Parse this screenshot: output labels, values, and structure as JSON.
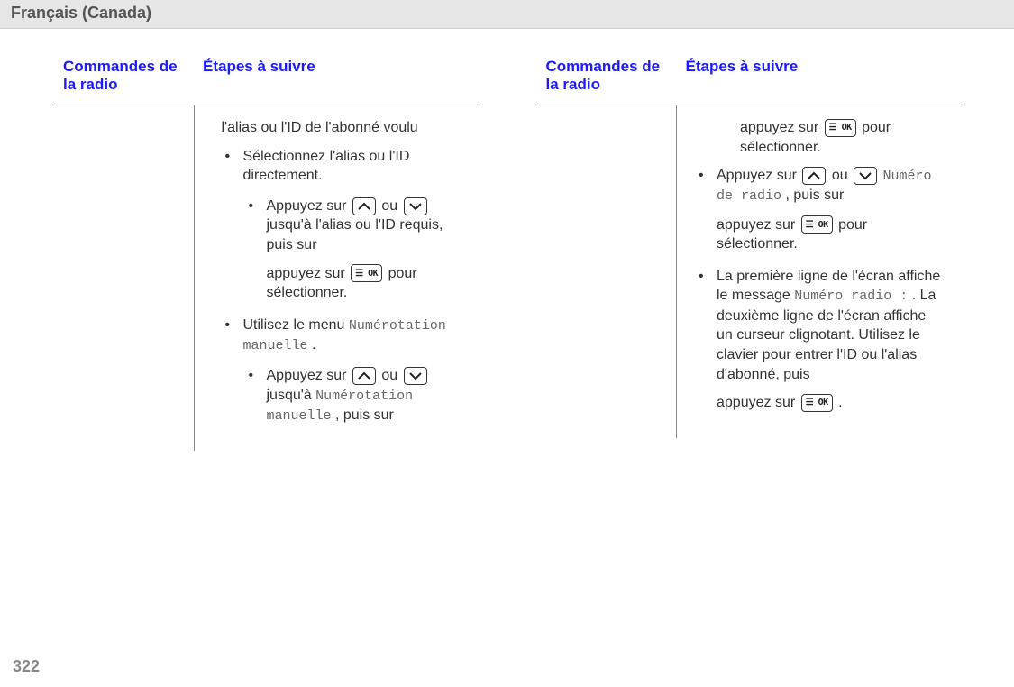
{
  "header": {
    "title": "Français (Canada)"
  },
  "page_number": "322",
  "table_headers": {
    "col1": "Commandes de la radio",
    "col2": "Étapes à suivre"
  },
  "icons": {
    "up": "up-arrow",
    "down": "down-arrow",
    "ok": "menu-ok"
  },
  "left": {
    "intro": "l'alias ou l'ID de l'abonné voulu",
    "b1": "Sélectionnez l'alias ou l'ID directement.",
    "b1_s1_a": "Appuyez sur ",
    "b1_s1_b": " ou ",
    "b1_s1_c": " jusqu'à l'alias ou l'ID requis, puis sur",
    "b1_s1_d": "appuyez sur ",
    "b1_s1_e": " pour sélectionner.",
    "b2_a": "Utilisez le menu ",
    "b2_mono": "Numérotation manuelle",
    "b2_b": ".",
    "b2_s1_a": "Appuyez sur ",
    "b2_s1_b": " ou ",
    "b2_s1_c": " jusqu'à ",
    "b2_s1_mono": "Numérotation manuelle",
    "b2_s1_d": ", puis sur"
  },
  "right": {
    "r0_a": "appuyez sur ",
    "r0_b": " pour sélectionner.",
    "r1_a": "Appuyez sur ",
    "r1_b": " ou ",
    "r1_c": " ",
    "r1_mono1": "Numéro de radio",
    "r1_d": ", puis sur",
    "r1_e": "appuyez sur ",
    "r1_f": " pour sélectionner.",
    "r2_a": "La première ligne de l'écran affiche le message ",
    "r2_mono": "Numéro radio :",
    "r2_b": ". La deuxième ligne de l'écran affiche un curseur clignotant. Utilisez le clavier pour entrer l'ID ou l'alias d'abonné, puis",
    "r2_c": "appuyez sur ",
    "r2_d": " ."
  }
}
